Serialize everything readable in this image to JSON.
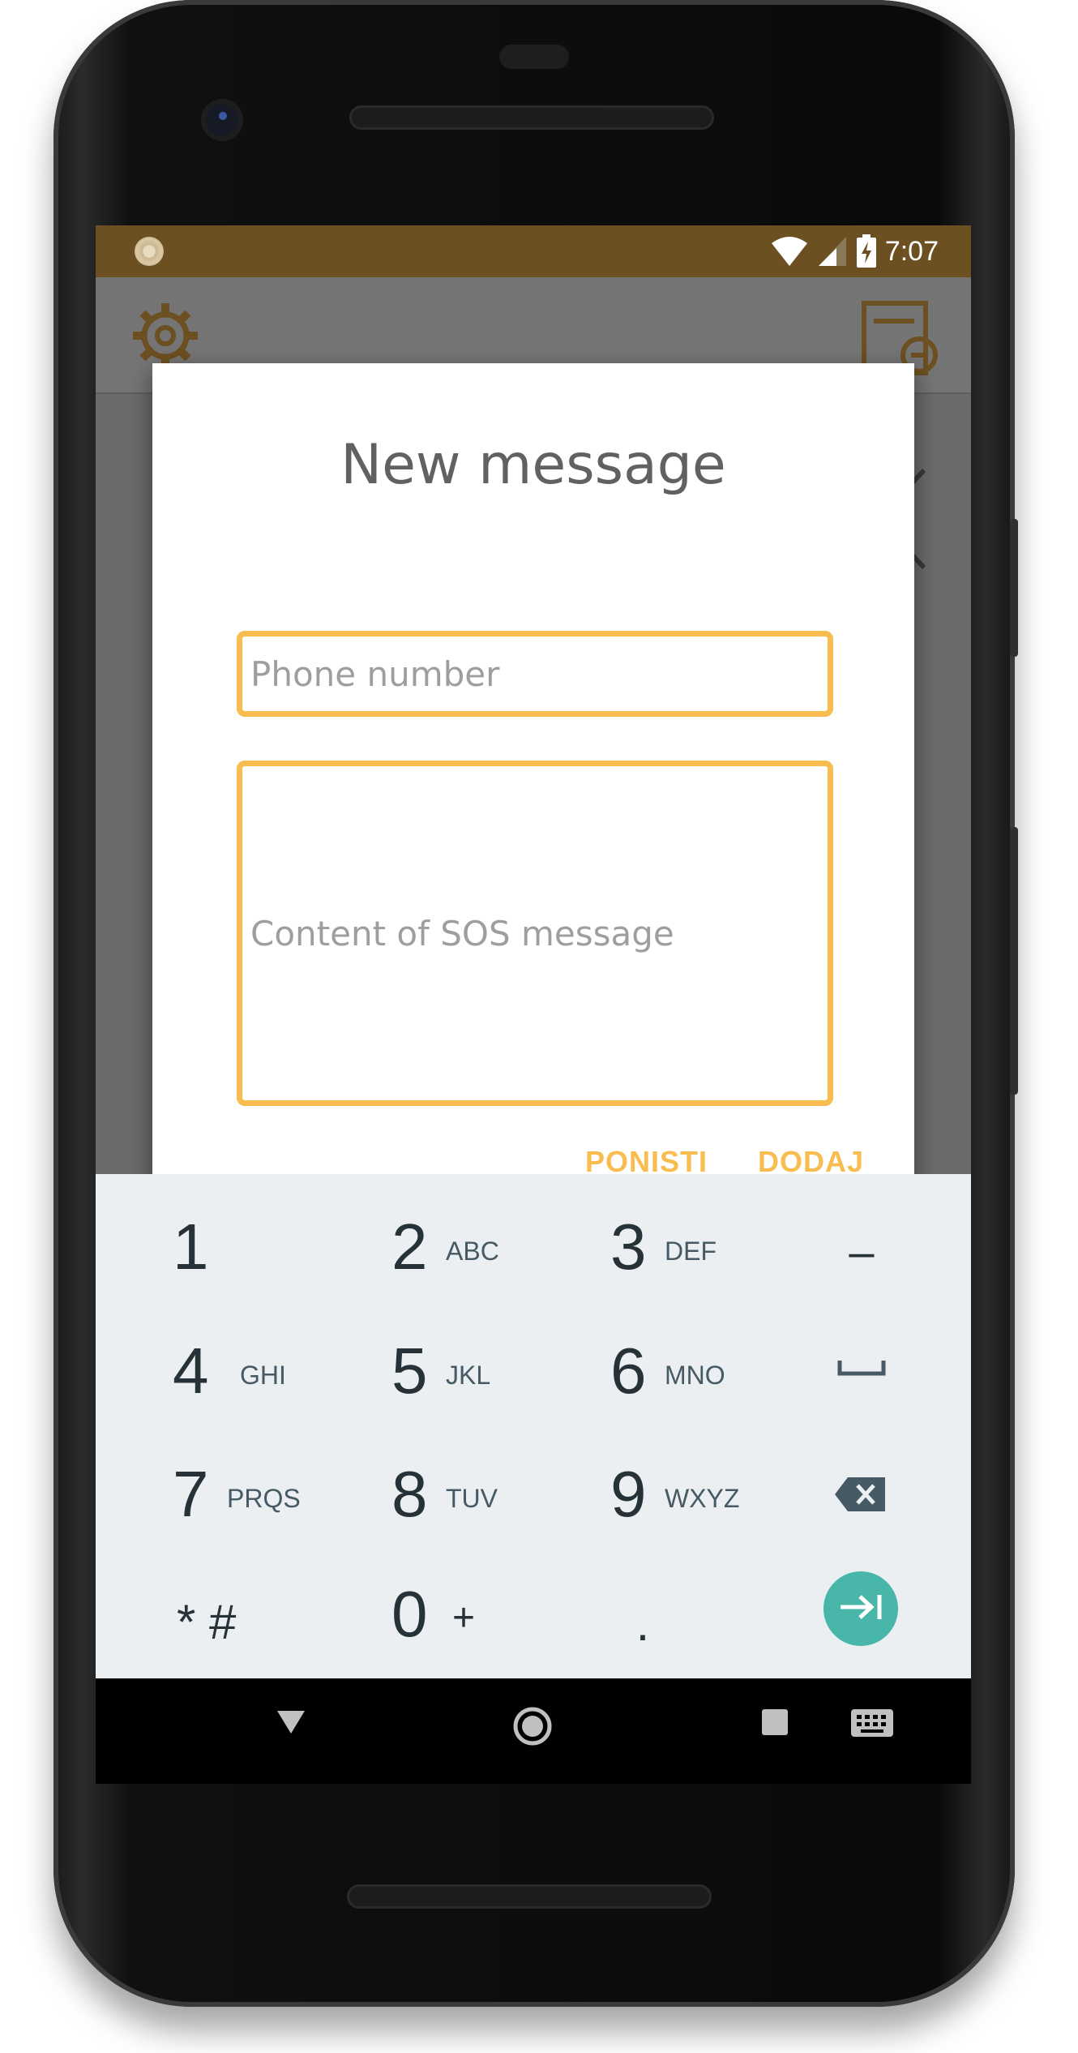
{
  "status_bar": {
    "time": "7:07",
    "icons": [
      "app-notification-icon",
      "wifi-icon",
      "cellular-signal-icon",
      "battery-charging-icon"
    ]
  },
  "background_app": {
    "toolbar_icons": [
      "gear-icon",
      "document-icon"
    ]
  },
  "dialog": {
    "title": "New message",
    "phone_field": {
      "placeholder": "Phone number",
      "value": ""
    },
    "content_field": {
      "placeholder": "Content of SOS message",
      "value": ""
    },
    "cancel_label": "PONISTI",
    "add_label": "DODAJ",
    "accent_color": "#f9bc4e"
  },
  "keyboard": {
    "type": "numeric",
    "rows": [
      [
        {
          "main": "1",
          "sub": ""
        },
        {
          "main": "2",
          "sub": "ABC"
        },
        {
          "main": "3",
          "sub": "DEF"
        },
        {
          "main": "–",
          "sub": ""
        }
      ],
      [
        {
          "main": "4",
          "sub": "GHI"
        },
        {
          "main": "5",
          "sub": "JKL"
        },
        {
          "main": "6",
          "sub": "MNO"
        },
        {
          "main": "space",
          "sub": ""
        }
      ],
      [
        {
          "main": "7",
          "sub": "PRQS"
        },
        {
          "main": "8",
          "sub": "TUV"
        },
        {
          "main": "9",
          "sub": "WXYZ"
        },
        {
          "main": "backspace",
          "sub": ""
        }
      ],
      [
        {
          "main": "* #",
          "sub": ""
        },
        {
          "main": "0",
          "sub": "+"
        },
        {
          "main": ".",
          "sub": ""
        },
        {
          "main": "next",
          "sub": ""
        }
      ]
    ],
    "enter_color": "#48b6a8"
  },
  "nav_bar": {
    "icons": [
      "back-icon",
      "home-icon",
      "recents-icon",
      "keyboard-switch-icon"
    ]
  }
}
